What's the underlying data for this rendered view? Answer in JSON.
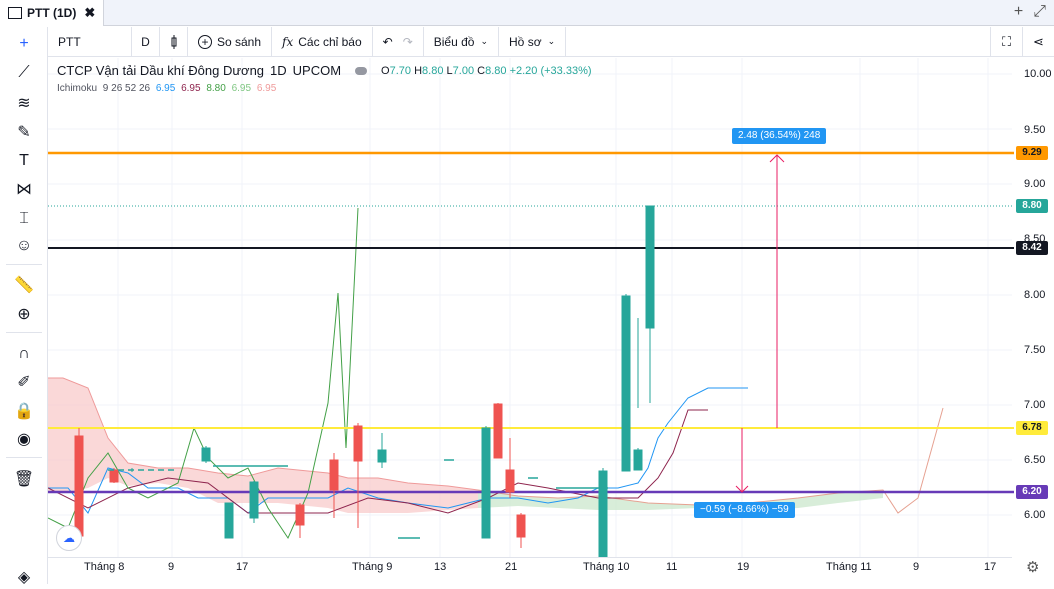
{
  "tab": {
    "title": "PTT (1D)",
    "close": "✖"
  },
  "titlebar_right": {
    "add": "+",
    "expand": "⤢"
  },
  "toolbar": {
    "symbol": "PTT",
    "interval": "D",
    "compare": "So sánh",
    "indicators": "Các chỉ báo",
    "chart_type": "Biểu đồ",
    "profile": "Hồ sơ"
  },
  "legend": {
    "name": "CTCP Vận tải Dầu khí Đông Dương",
    "interval": "1D",
    "exchange": "UPCOM",
    "o_label": "O",
    "o": "7.70",
    "h_label": "H",
    "h": "8.80",
    "l_label": "L",
    "l": "7.00",
    "c_label": "C",
    "c": "8.80",
    "change": "+2.20 (+33.33%)"
  },
  "indicator": {
    "name": "Ichimoku",
    "params": "9 26 52 26",
    "v1": "6.95",
    "v2": "6.95",
    "v3": "8.80",
    "v4": "6.95",
    "v5": "6.95"
  },
  "price_axis": [
    "10.00",
    "9.50",
    "9.00",
    "8.50",
    "8.00",
    "7.50",
    "7.00",
    "6.50",
    "6.00"
  ],
  "price_tags": {
    "orange": "9.29",
    "last": "8.80",
    "black": "8.42",
    "yellow": "6.78",
    "purple": "6.20"
  },
  "annotations": {
    "up": "2.48 (36.54%) 248",
    "down": "−0.59 (−8.66%) −59"
  },
  "date_axis": [
    "Tháng 8",
    "9",
    "17",
    "Tháng 9",
    "13",
    "21",
    "Tháng 10",
    "11",
    "19",
    "Tháng 11",
    "9",
    "17"
  ],
  "colors": {
    "up": "#26a69a",
    "down": "#ef5350",
    "orange": "#ff9800",
    "yellow": "#ffeb3b",
    "purple": "#673ab7",
    "accent": "#2196f3"
  }
}
